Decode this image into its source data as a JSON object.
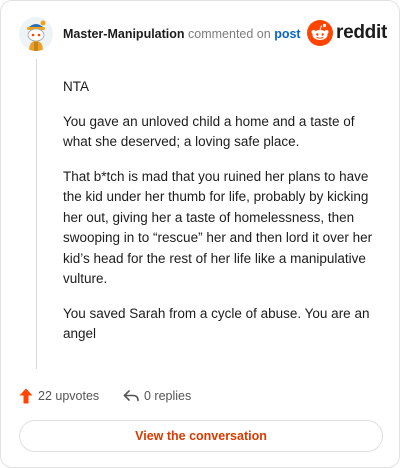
{
  "header": {
    "username": "Master-Manipulation",
    "action_text": "commented on",
    "post_link": "post",
    "brand": "reddit"
  },
  "comment": {
    "paragraphs": [
      "NTA",
      "You gave an unloved child a home and a taste of what she deserved; a loving safe place.",
      "That b*tch is mad that you ruined her plans to have the kid under her thumb for life, probably by kicking her out, giving her a taste of homelessness, then swooping in to “rescue” her and then lord it over her kid’s head for the rest of her life like a manipulative vulture.",
      "You saved Sarah from a cycle of abuse. You are an angel"
    ]
  },
  "actions": {
    "upvotes": "22 upvotes",
    "replies": "0 replies"
  },
  "cta": {
    "label": "View the conversation"
  },
  "colors": {
    "accent": "#ff4500",
    "link": "#0a66c2",
    "cta_text": "#d93a00"
  },
  "icons": {
    "avatar": "snoo-avatar-icon",
    "brand": "reddit-logo-icon",
    "upvote": "upvote-arrow-icon",
    "reply": "reply-arrow-icon"
  }
}
